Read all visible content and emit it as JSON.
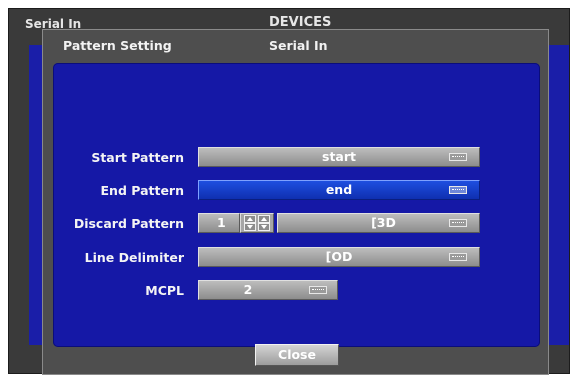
{
  "background_window": {
    "title_left": "Serial In",
    "title_center": "DEVICES"
  },
  "dialog": {
    "title": "Pattern Setting",
    "subtitle": "Serial In"
  },
  "form": {
    "start_pattern": {
      "label": "Start Pattern",
      "value": "start"
    },
    "end_pattern": {
      "label": "End Pattern",
      "value": "end"
    },
    "discard_pattern": {
      "label": "Discard Pattern",
      "count": "1",
      "value": "[3D"
    },
    "line_delimiter": {
      "label": "Line Delimiter",
      "value": "[OD"
    },
    "mcpl": {
      "label": "MCPL",
      "value": "2"
    }
  },
  "buttons": {
    "close": "Close"
  },
  "colors": {
    "panel_blue": "#1518a6",
    "selected_field": "#1e4fe0",
    "dialog_gray": "#4e4e4e"
  }
}
